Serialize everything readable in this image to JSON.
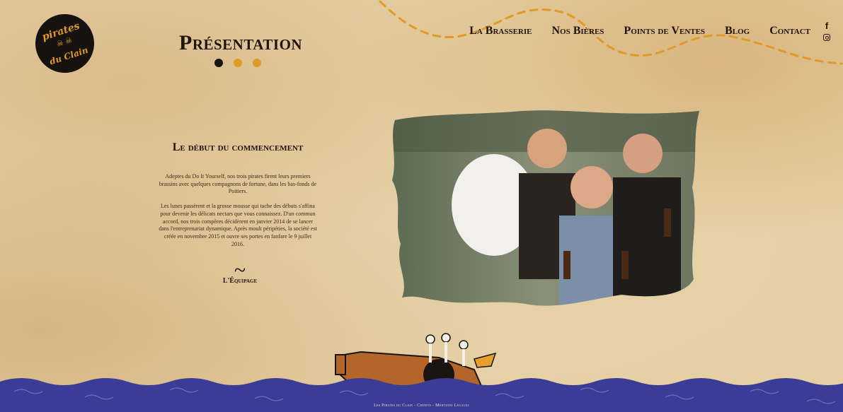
{
  "brand": {
    "logo_line1": "pirates",
    "logo_line2": "du Clain",
    "skulls": "☠ ☠"
  },
  "page": {
    "title": "Présentation"
  },
  "nav": [
    {
      "label": "La Brasserie"
    },
    {
      "label": "Nos Bières"
    },
    {
      "label": "Points de Ventes"
    },
    {
      "label": "Blog"
    },
    {
      "label": "Contact"
    }
  ],
  "social": {
    "facebook": "f",
    "instagram_icon": "instagram-icon"
  },
  "carousel": {
    "count": 3,
    "active_index": 0
  },
  "section": {
    "title": "Le début du commencement",
    "paragraph1": "Adeptes du Do It Yourself, nos trois pirates firent leurs premiers brassins avec quelques compagnons de fortune, dans les bas-fonds de Poitiers.",
    "paragraph2": "Les lunes passèrent et la grosse mousse qui tache des débuts s'affina pour devenir les délicats nectars que vous connaissez. D'un commun accord, nos trois compères décidèrent en janvier 2014 de se lancer dans l'entreprenariat dynamique. Après moult péripéties, la société est créée en novembre 2015 et ouvre ses portes en fanfare le 9 juillet 2016.",
    "link_label": "L'Équipage"
  },
  "footer": {
    "text": "Les Pirates du Clain - Crédits - Mentions Légales"
  },
  "colors": {
    "accent": "#e09a28",
    "sea": "#3a3c95",
    "ink": "#1d140c"
  }
}
